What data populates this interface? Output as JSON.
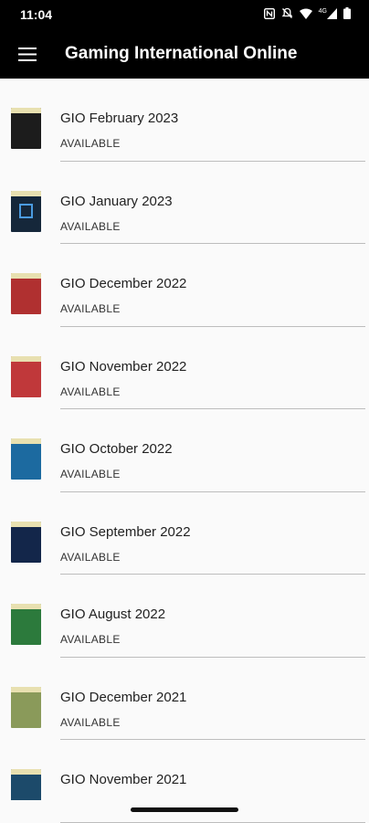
{
  "status_bar": {
    "time": "11:04",
    "icons": [
      "nfc-icon",
      "silent-icon",
      "wifi-icon",
      "network-4g-icon",
      "battery-icon"
    ],
    "network_label": "4G"
  },
  "app_bar": {
    "title": "Gaming International Online",
    "menu_icon": "hamburger-menu-icon"
  },
  "issues": [
    {
      "title": "GIO February 2023",
      "status": "AVAILABLE",
      "cover_color": "#1c1c1c"
    },
    {
      "title": "GIO January 2023",
      "status": "AVAILABLE",
      "cover_color": "#15273a"
    },
    {
      "title": "GIO December 2022",
      "status": "AVAILABLE",
      "cover_color": "#b03030"
    },
    {
      "title": "GIO November 2022",
      "status": "AVAILABLE",
      "cover_color": "#c0383a"
    },
    {
      "title": "GIO October 2022",
      "status": "AVAILABLE",
      "cover_color": "#1c6aa0"
    },
    {
      "title": "GIO September 2022",
      "status": "AVAILABLE",
      "cover_color": "#13264a"
    },
    {
      "title": "GIO August 2022",
      "status": "AVAILABLE",
      "cover_color": "#2c7a3c"
    },
    {
      "title": "GIO December 2021",
      "status": "AVAILABLE",
      "cover_color": "#8a9a5a"
    },
    {
      "title": "GIO November 2021",
      "status": "",
      "cover_color": "#1c4a6a"
    }
  ]
}
